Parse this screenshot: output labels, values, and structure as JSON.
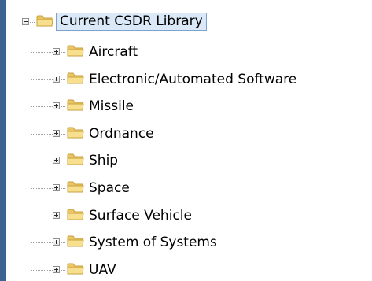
{
  "tree": {
    "root": {
      "label": "Current CSDR Library",
      "expanded": true,
      "selected": true
    },
    "children": [
      {
        "label": "Aircraft",
        "expanded": false
      },
      {
        "label": "Electronic/Automated Software",
        "expanded": false
      },
      {
        "label": "Missile",
        "expanded": false
      },
      {
        "label": "Ordnance",
        "expanded": false
      },
      {
        "label": "Ship",
        "expanded": false
      },
      {
        "label": "Space",
        "expanded": false
      },
      {
        "label": "Surface Vehicle",
        "expanded": false
      },
      {
        "label": "System of Systems",
        "expanded": false
      },
      {
        "label": "UAV",
        "expanded": false
      }
    ]
  },
  "colors": {
    "background": "#3b6490",
    "panel": "#ffffff",
    "selection_fill": "#dbe8f7",
    "selection_border": "#7da2ce",
    "folder_fill": "#f2d57a",
    "folder_border": "#c9a13a"
  },
  "icons": {
    "folder": "folder-icon",
    "expand": "expand-plus-icon",
    "collapse": "collapse-minus-icon"
  }
}
